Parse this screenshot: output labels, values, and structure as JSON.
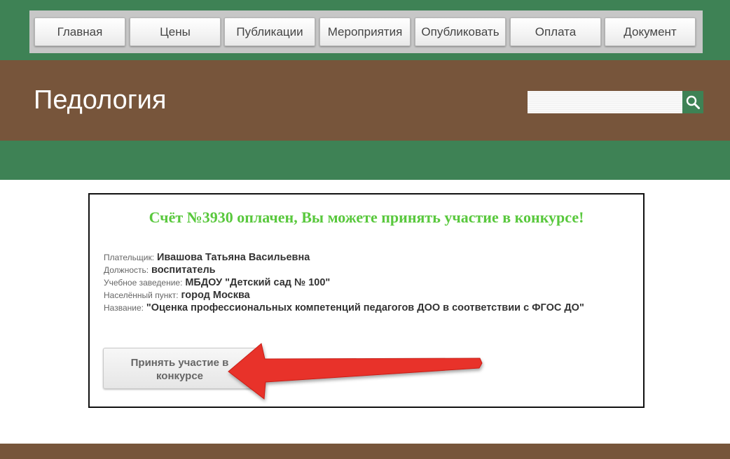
{
  "nav": {
    "items": [
      {
        "label": "Главная"
      },
      {
        "label": "Цены"
      },
      {
        "label": "Публикации"
      },
      {
        "label": "Мероприятия"
      },
      {
        "label": "Опубликовать"
      },
      {
        "label": "Оплата"
      },
      {
        "label": "Документ"
      }
    ]
  },
  "header": {
    "site_title": "Педология",
    "search_placeholder": "",
    "search_icon": "search-icon"
  },
  "card": {
    "title": "Счёт №3930 оплачен, Вы можете принять участие в конкурсе!",
    "fields": [
      {
        "label": "Плательщик:",
        "value": "Ивашова Татьяна Васильевна"
      },
      {
        "label": "Должность:",
        "value": "воспитатель"
      },
      {
        "label": "Учебное заведение:",
        "value": "МБДОУ \"Детский сад № 100\""
      },
      {
        "label": "Населённый пункт:",
        "value": "город Москва"
      },
      {
        "label": "Название:",
        "value": "\"Оценка профессиональных компетенций педагогов ДОО в соответствии с ФГОС ДО\""
      }
    ],
    "join_button": "Принять участие в конкурсе"
  },
  "colors": {
    "green": "#3e8255",
    "brown": "#77553b",
    "title_green": "#59c83d",
    "arrow_red": "#e8332a"
  }
}
